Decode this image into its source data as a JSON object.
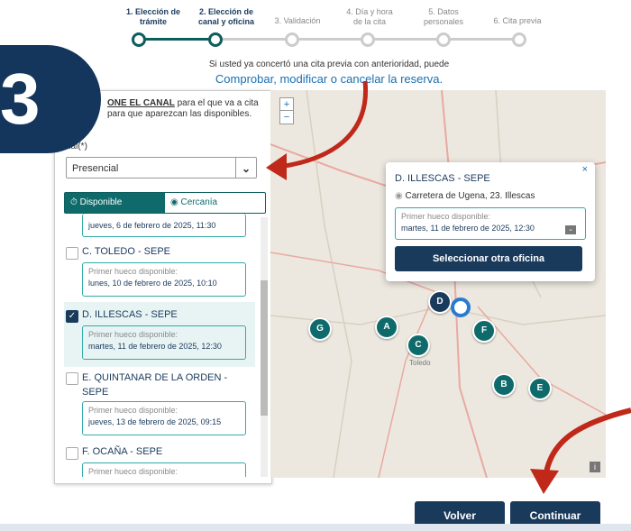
{
  "stepper": {
    "steps": [
      {
        "label": "1. Elección de\ntrámite",
        "done": true
      },
      {
        "label": "2. Elección de\ncanal y oficina",
        "done": true
      },
      {
        "label": "3. Validación",
        "done": false
      },
      {
        "label": "4. Día y hora\nde la cita",
        "done": false
      },
      {
        "label": "5. Datos\npersonales",
        "done": false
      },
      {
        "label": "6. Cita previa",
        "done": false
      }
    ]
  },
  "notice": "Si usted ya concertó una cita previa con anterioridad, puede",
  "notice_link": "Comprobar, modificar o cancelar la reserva.",
  "overlay_badge": "3",
  "panel": {
    "intro_strong": "ONE EL CANAL",
    "intro_rest": "para el que va a cita para que aparezcan las disponibles.",
    "canal_label": "nal(*)",
    "canal_value": "Presencial",
    "tab_available": "Disponible",
    "tab_nearby": "Cercanía",
    "offices": [
      {
        "name": "",
        "slot_label": "",
        "slot_date": "jueves, 6 de febrero de 2025, 11:30",
        "checked": false
      },
      {
        "name": "C. TOLEDO - SEPE",
        "slot_label": "Primer hueco disponible:",
        "slot_date": "lunes, 10 de febrero de 2025, 10:10",
        "checked": false
      },
      {
        "name": "D. ILLESCAS - SEPE",
        "slot_label": "Primer hueco disponible:",
        "slot_date": "martes, 11 de febrero de 2025, 12:30",
        "checked": true
      },
      {
        "name": "E. QUINTANAR DE LA ORDEN - SEPE",
        "slot_label": "Primer hueco disponible:",
        "slot_date": "jueves, 13 de febrero de 2025, 09:15",
        "checked": false
      },
      {
        "name": "F. OCAÑA - SEPE",
        "slot_label": "Primer hueco disponible:",
        "slot_date": "",
        "checked": false
      }
    ]
  },
  "map": {
    "zoom_in": "+",
    "zoom_out": "−",
    "markers": [
      "G",
      "A",
      "D",
      "C",
      "F",
      "B",
      "E"
    ],
    "town": "Toledo"
  },
  "popup": {
    "title": "D. ILLESCAS - SEPE",
    "close": "×",
    "address": "Carretera de Ugena, 23. Illescas",
    "slot_label": "Primer hueco disponible:",
    "slot_date": "martes, 11 de febrero de 2025, 12:30",
    "button": "Seleccionar otra oficina"
  },
  "buttons": {
    "back": "Volver",
    "continue": "Continuar"
  },
  "colors": {
    "primary": "#1a3a5c",
    "teal": "#0f6b6b",
    "link": "#1a6fb0",
    "arrow": "#c0281a"
  }
}
